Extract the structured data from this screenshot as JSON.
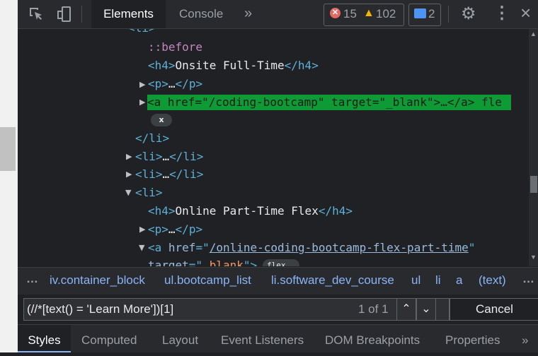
{
  "toolbar": {
    "tabs": {
      "elements": "Elements",
      "console": "Console"
    },
    "more_tabs": "»",
    "errors": "15",
    "warnings": "102",
    "messages": "2"
  },
  "tree": {
    "li_open_partial": "<li>",
    "before": "::before",
    "h4_onsite": [
      "<h4>",
      "Onsite Full-Time",
      "</h4>"
    ],
    "p_collapsed_1": [
      "<p>",
      "…",
      "</p>"
    ],
    "a_selected": [
      "<a ",
      "href",
      "=\"",
      "/coding-bootcamp",
      "\" ",
      "target",
      "=\"",
      "_blank",
      "\">",
      "…",
      "</a>",
      " fle"
    ],
    "close_pill": "x",
    "li_close": "</li>",
    "li_collapsed": [
      "<li>",
      "…",
      "</li>"
    ],
    "li_open": "<li>",
    "h4_online": [
      "<h4>",
      "Online Part-Time Flex",
      "</h4>"
    ],
    "p_collapsed_2": [
      "<p>",
      "…",
      "</p>"
    ],
    "a_expanded": [
      "<a ",
      "href",
      "=\"",
      "/online-coding-bootcamp-flex-part-time",
      "\""
    ],
    "a_target": [
      "target",
      "=\"",
      "_blank",
      "\">"
    ],
    "flex_pill": "flex"
  },
  "breadcrumbs": {
    "more": "…",
    "items": [
      "iv.container_block",
      "ul.bootcamp_list",
      "li.software_dev_course",
      "ul",
      "li",
      "a",
      "(text)"
    ],
    "more_right": "…"
  },
  "search": {
    "value": "(//*[text() = 'Learn More'])[1]",
    "match": "1 of 1",
    "cancel": "Cancel"
  },
  "bottom_tabs": [
    "Styles",
    "Computed",
    "Layout",
    "Event Listeners",
    "DOM Breakpoints",
    "Properties",
    "»"
  ],
  "colors": {
    "selection": "#0e9b35",
    "tag": "#5db0d7",
    "link": "#8ab4f8"
  }
}
